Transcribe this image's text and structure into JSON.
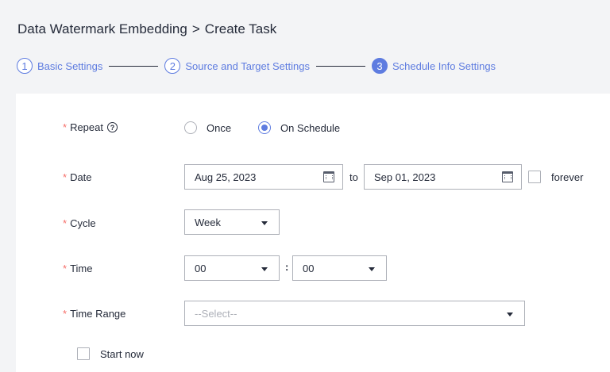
{
  "breadcrumb": {
    "parent": "Data Watermark Embedding",
    "separator": ">",
    "current": "Create Task"
  },
  "steps": [
    {
      "num": "1",
      "label": "Basic Settings"
    },
    {
      "num": "2",
      "label": "Source and Target Settings"
    },
    {
      "num": "3",
      "label": "Schedule Info Settings"
    }
  ],
  "form": {
    "required_mark": "*",
    "repeat": {
      "label": "Repeat",
      "help_icon": "question-circle-icon",
      "help_glyph": "?",
      "options": [
        "Once",
        "On Schedule"
      ],
      "selected": "On Schedule"
    },
    "date": {
      "label": "Date",
      "start": "Aug 25, 2023",
      "to": "to",
      "end": "Sep 01, 2023",
      "forever_label": "forever",
      "forever_checked": false
    },
    "cycle": {
      "label": "Cycle",
      "value": "Week"
    },
    "time": {
      "label": "Time",
      "hour": "00",
      "colon": ":",
      "minute": "00"
    },
    "time_range": {
      "label": "Time Range",
      "placeholder": "--Select--"
    },
    "start_now": {
      "label": "Start now",
      "checked": false
    }
  },
  "colors": {
    "accent": "#5e7ce0",
    "required": "#f66f6a",
    "border": "#adb0b8"
  }
}
